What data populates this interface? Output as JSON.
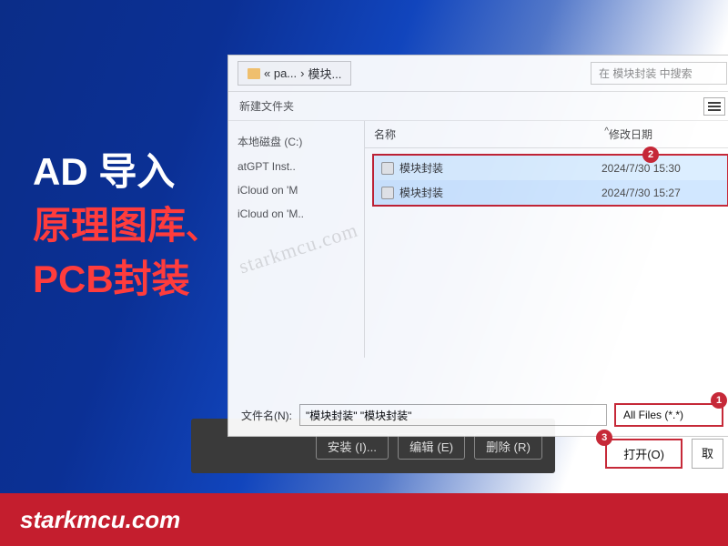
{
  "headline": {
    "line1": "AD 导入",
    "line2": "原理图库",
    "comma": "、",
    "line3": "PCB封装"
  },
  "footer": {
    "site": "starkmcu.com"
  },
  "watermark": "starkmcu.com",
  "dialog": {
    "breadcrumb": {
      "prefix": "« pa...",
      "sep": "›",
      "current": "模块..."
    },
    "search_placeholder": "在 模块封装 中搜索",
    "toolbar_new": "新建文件夹",
    "columns": {
      "name": "名称",
      "date": "修改日期"
    },
    "sidebar": [
      "本地磁盘 (C:)",
      "atGPT Inst..",
      "iCloud on 'M",
      "iCloud on 'M.."
    ],
    "files": [
      {
        "name": "模块封装",
        "date": "2024/7/30 15:30"
      },
      {
        "name": "模块封装",
        "date": "2024/7/30 15:27"
      }
    ],
    "filename_label": "文件名(N):",
    "filename_value": "\"模块封装\" \"模块封装\"",
    "filetype": "All Files (*.*)",
    "open_btn": "打开(O)",
    "badges": {
      "b1": "1",
      "b2": "2",
      "b3": "3"
    }
  },
  "dark_panel": {
    "install": "安装 (I)...",
    "edit": "编辑 (E)",
    "delete": "删除 (R)"
  }
}
